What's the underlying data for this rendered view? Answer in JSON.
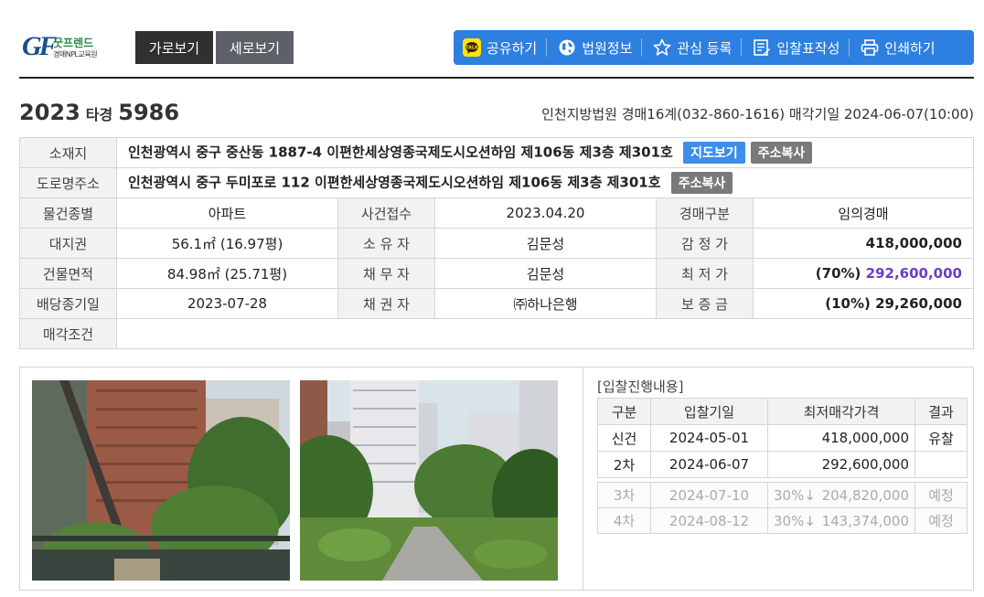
{
  "logo": {
    "mark": "GF",
    "brand": "굿프렌드",
    "sub": "경매NPL교육원"
  },
  "view_tabs": {
    "horizontal": "가로보기",
    "vertical": "세로보기"
  },
  "toolbar": {
    "share": "공유하기",
    "court_info": "법원정보",
    "favorite": "관심 등록",
    "bid_form": "입찰표작성",
    "print": "인쇄하기"
  },
  "case": {
    "year": "2023",
    "type": "타경",
    "number": "5986"
  },
  "court_info": "인천지방법원 경매16계(032-860-1616) 매각기일 2024-06-07(10:00)",
  "info": {
    "address_label": "소재지",
    "address": "인천광역시 중구 중산동 1887-4 이편한세상영종국제도시오션하임 제106동 제3층 제301호",
    "map_btn": "지도보기",
    "copy_btn": "주소복사",
    "road_label": "도로명주소",
    "road_address": "인천광역시 중구 두미포로 112 이편한세상영종국제도시오션하임 제106동 제3층 제301호",
    "copy_btn2": "주소복사",
    "rows": [
      {
        "l1": "물건종별",
        "v1": "아파트",
        "l2": "사건접수",
        "v2": "2023.04.20",
        "l3": "경매구분",
        "v3": "임의경매"
      },
      {
        "l1": "대지권",
        "v1": "56.1㎡ (16.97평)",
        "l2": "소 유 자",
        "v2": "김문성",
        "l3": "감 정 가",
        "v3": "418,000,000"
      },
      {
        "l1": "건물면적",
        "v1": "84.98㎡ (25.71평)",
        "l2": "채 무 자",
        "v2": "김문성",
        "l3": "최 저 가",
        "v3_pct": "(70%)",
        "v3": "292,600,000"
      },
      {
        "l1": "배당종기일",
        "v1": "2023-07-28",
        "l2": "채 권 자",
        "v2": "㈜하나은행",
        "l3": "보 증 금",
        "v3": "(10%) 29,260,000"
      }
    ],
    "sale_cond_label": "매각조건"
  },
  "bid": {
    "title": "[입찰진행내용]",
    "headers": [
      "구분",
      "입찰기일",
      "최저매각가격",
      "결과"
    ],
    "rows": [
      {
        "round": "신건",
        "date": "2024-05-01",
        "price": "418,000,000",
        "result": "유찰"
      },
      {
        "round": "2차",
        "date": "2024-06-07",
        "price": "292,600,000",
        "result": ""
      }
    ],
    "future": [
      {
        "round": "3차",
        "date": "2024-07-10",
        "pct": "30%↓",
        "price": "204,820,000",
        "result": "예정"
      },
      {
        "round": "4차",
        "date": "2024-08-12",
        "pct": "30%↓",
        "price": "143,374,000",
        "result": "예정"
      }
    ]
  },
  "colors": {
    "toolbar": "#2d7fe0",
    "accent_purple": "#6a3fc8",
    "tag_blue": "#3c8ee8"
  }
}
